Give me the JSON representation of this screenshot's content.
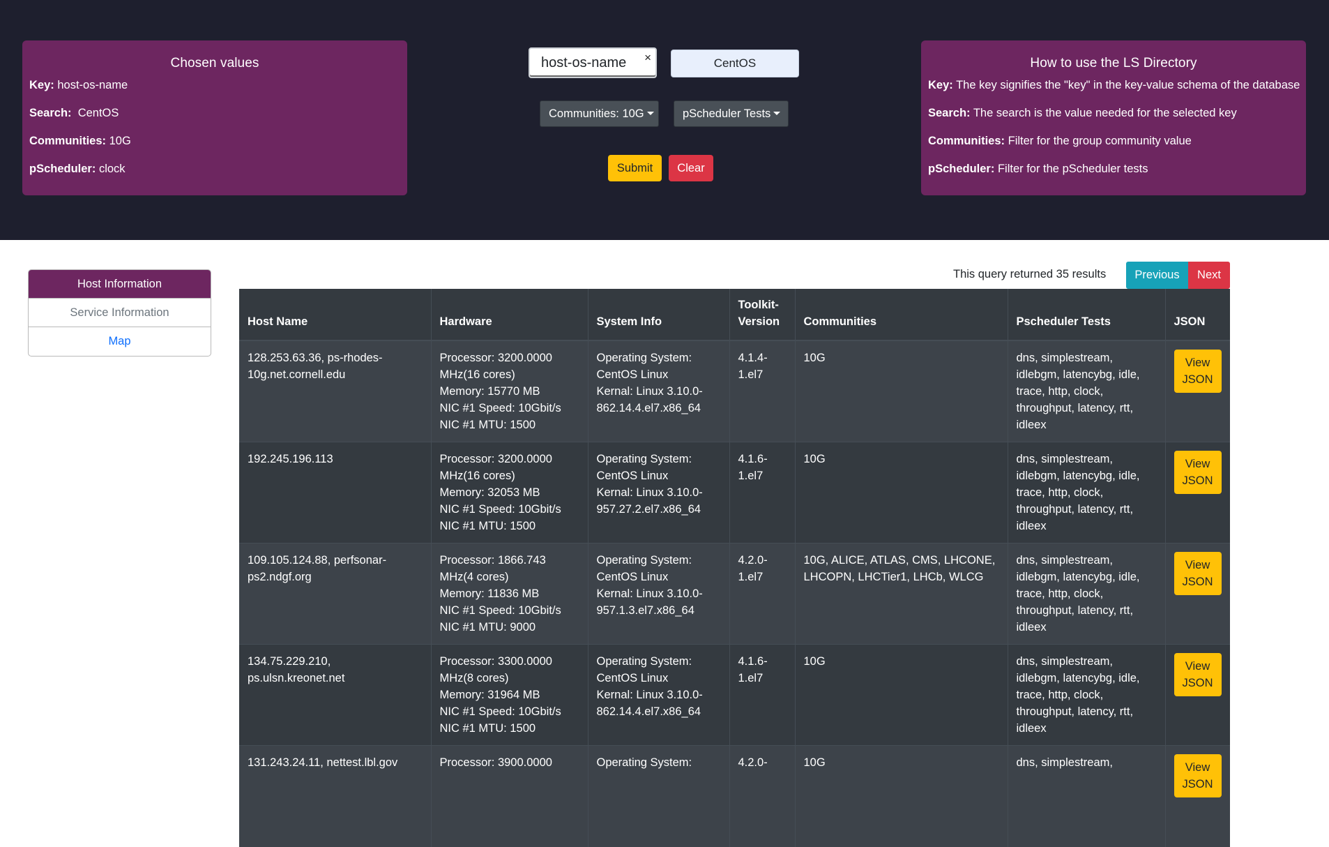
{
  "chosen": {
    "title": "Chosen values",
    "key_label": "Key:",
    "key_value": "host-os-name",
    "search_label": "Search:",
    "search_value": "CentOS",
    "communities_label": "Communities:",
    "communities_value": "10G",
    "pscheduler_label": "pScheduler:",
    "pscheduler_value": "clock"
  },
  "help": {
    "title": "How to use the LS Directory",
    "key_label": "Key:",
    "key_text": "The key signifies the \"key\" in the key-value schema of the database",
    "search_label": "Search:",
    "search_text": "The search is the value needed for the selected key",
    "communities_label": "Communities:",
    "communities_text": "Filter for the group community value",
    "pscheduler_label": "pScheduler:",
    "pscheduler_text": "Filter for the pScheduler tests"
  },
  "controls": {
    "key_input_value": "host-os-name",
    "key_clear": "×",
    "search_value": "CentOS",
    "communities_dropdown": "Communities: 10G",
    "pscheduler_dropdown": "pScheduler Tests",
    "submit_label": "Submit",
    "clear_label": "Clear"
  },
  "sidebar": {
    "items": [
      {
        "label": "Host Information"
      },
      {
        "label": "Service Information"
      },
      {
        "label": "Map"
      }
    ]
  },
  "results": {
    "summary": "This query returned 35 results",
    "prev_label": "Previous",
    "next_label": "Next"
  },
  "table": {
    "headers": [
      "Host Name",
      "Hardware",
      "System Info",
      "Toolkit-\nVersion",
      "Communities",
      "Pscheduler Tests",
      "JSON"
    ],
    "json_button_label": "View\nJSON",
    "rows": [
      {
        "host": "128.253.63.36, ps-rhodes-10g.net.cornell.edu",
        "hardware": "Processor: 3200.0000 MHz(16 cores)\nMemory: 15770 MB\nNIC #1 Speed: 10Gbit/s\nNIC #1 MTU: 1500",
        "system": "Operating System: CentOS Linux\nKernal: Linux 3.10.0-862.14.4.el7.x86_64",
        "toolkit": "4.1.4-1.el7",
        "communities": "10G",
        "tests": "dns, simplestream, idlebgm, latencybg, idle, trace, http, clock, throughput, latency, rtt, idleex"
      },
      {
        "host": "192.245.196.113",
        "hardware": "Processor: 3200.0000 MHz(16 cores)\nMemory: 32053 MB\nNIC #1 Speed: 10Gbit/s\nNIC #1 MTU: 1500",
        "system": "Operating System: CentOS Linux\nKernal: Linux 3.10.0-957.27.2.el7.x86_64",
        "toolkit": "4.1.6-1.el7",
        "communities": "10G",
        "tests": "dns, simplestream, idlebgm, latencybg, idle, trace, http, clock, throughput, latency, rtt, idleex"
      },
      {
        "host": "109.105.124.88, perfsonar-ps2.ndgf.org",
        "hardware": "Processor: 1866.743 MHz(4 cores)\nMemory: 11836 MB\nNIC #1 Speed: 10Gbit/s\nNIC #1 MTU: 9000",
        "system": "Operating System: CentOS Linux\nKernal: Linux 3.10.0-957.1.3.el7.x86_64",
        "toolkit": "4.2.0-1.el7",
        "communities": "10G, ALICE, ATLAS, CMS, LHCONE, LHCOPN, LHCTier1, LHCb, WLCG",
        "tests": "dns, simplestream, idlebgm, latencybg, idle, trace, http, clock, throughput, latency, rtt, idleex"
      },
      {
        "host": "134.75.229.210, ps.ulsn.kreonet.net",
        "hardware": "Processor: 3300.0000 MHz(8 cores)\nMemory: 31964 MB\nNIC #1 Speed: 10Gbit/s\nNIC #1 MTU: 1500",
        "system": "Operating System: CentOS Linux\nKernal: Linux 3.10.0-862.14.4.el7.x86_64",
        "toolkit": "4.1.6-1.el7",
        "communities": "10G",
        "tests": "dns, simplestream, idlebgm, latencybg, idle, trace, http, clock, throughput, latency, rtt, idleex"
      },
      {
        "host": "131.243.24.11, nettest.lbl.gov",
        "hardware": "Processor: 3900.0000",
        "system": "Operating System:",
        "toolkit": "4.2.0-",
        "communities": "10G",
        "tests": "dns, simplestream,"
      }
    ]
  },
  "colors": {
    "header_bg": "#1e1f2e",
    "card_purple": "#6d2660",
    "table_bg": "#343a40",
    "warning": "#ffc107",
    "danger": "#dc3545",
    "info": "#17a2b8"
  }
}
